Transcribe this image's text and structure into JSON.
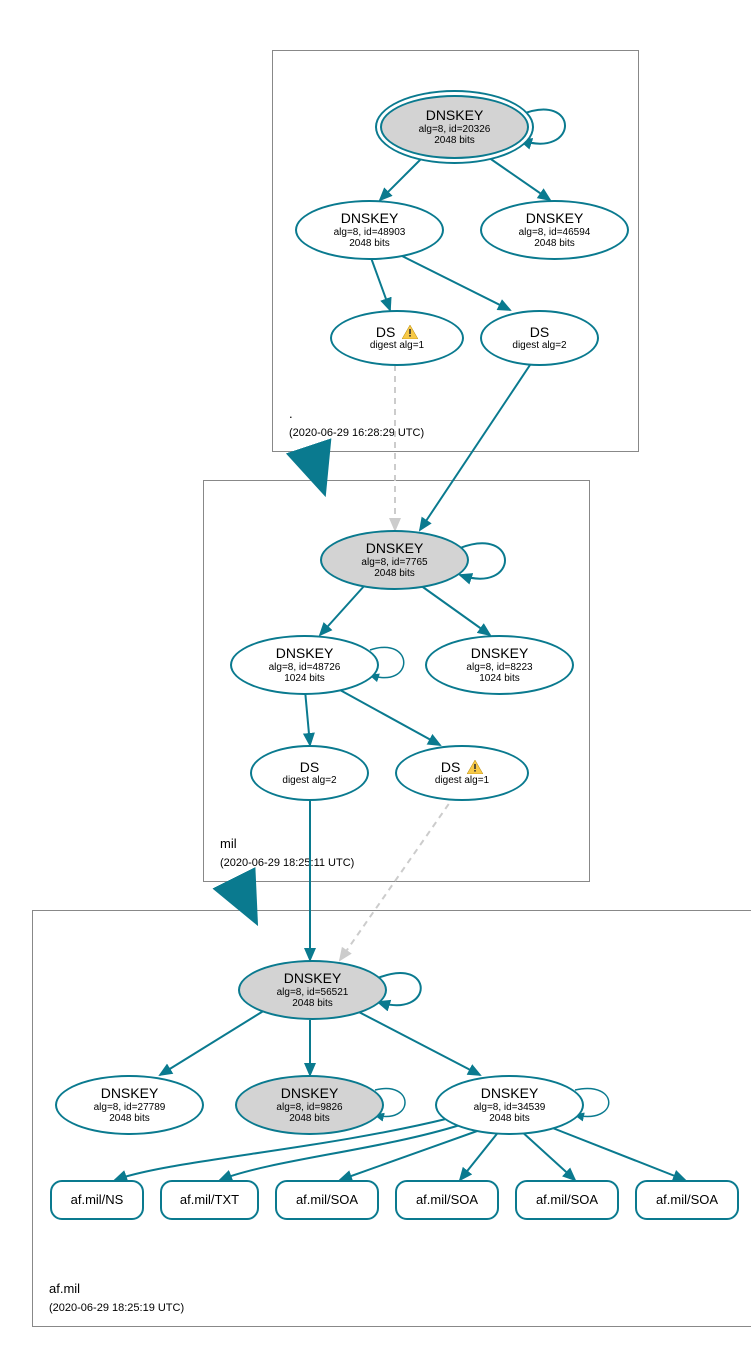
{
  "colors": {
    "stroke": "#0a7a8f",
    "gray": "#d3d3d3",
    "dashed": "#cccccc"
  },
  "zones": {
    "root": {
      "label": ".",
      "timestamp": "(2020-06-29 16:28:29 UTC)"
    },
    "mil": {
      "label": "mil",
      "timestamp": "(2020-06-29 18:25:11 UTC)"
    },
    "afmil": {
      "label": "af.mil",
      "timestamp": "(2020-06-29 18:25:19 UTC)"
    }
  },
  "nodes": {
    "root_ksk": {
      "title": "DNSKEY",
      "line2": "alg=8, id=20326",
      "line3": "2048 bits"
    },
    "root_zsk1": {
      "title": "DNSKEY",
      "line2": "alg=8, id=48903",
      "line3": "2048 bits"
    },
    "root_zsk2": {
      "title": "DNSKEY",
      "line2": "alg=8, id=46594",
      "line3": "2048 bits"
    },
    "root_ds1": {
      "title": "DS",
      "line2": "digest alg=1",
      "warn": true
    },
    "root_ds2": {
      "title": "DS",
      "line2": "digest alg=2"
    },
    "mil_ksk": {
      "title": "DNSKEY",
      "line2": "alg=8, id=7765",
      "line3": "2048 bits"
    },
    "mil_zsk1": {
      "title": "DNSKEY",
      "line2": "alg=8, id=48726",
      "line3": "1024 bits"
    },
    "mil_zsk2": {
      "title": "DNSKEY",
      "line2": "alg=8, id=8223",
      "line3": "1024 bits"
    },
    "mil_ds2": {
      "title": "DS",
      "line2": "digest alg=2"
    },
    "mil_ds1": {
      "title": "DS",
      "line2": "digest alg=1",
      "warn": true
    },
    "af_ksk": {
      "title": "DNSKEY",
      "line2": "alg=8, id=56521",
      "line3": "2048 bits"
    },
    "af_zsk1": {
      "title": "DNSKEY",
      "line2": "alg=8, id=27789",
      "line3": "2048 bits"
    },
    "af_zsk2": {
      "title": "DNSKEY",
      "line2": "alg=8, id=9826",
      "line3": "2048 bits"
    },
    "af_zsk3": {
      "title": "DNSKEY",
      "line2": "alg=8, id=34539",
      "line3": "2048 bits"
    },
    "rr1": {
      "title": "af.mil/NS"
    },
    "rr2": {
      "title": "af.mil/TXT"
    },
    "rr3": {
      "title": "af.mil/SOA"
    },
    "rr4": {
      "title": "af.mil/SOA"
    },
    "rr5": {
      "title": "af.mil/SOA"
    },
    "rr6": {
      "title": "af.mil/SOA"
    }
  }
}
